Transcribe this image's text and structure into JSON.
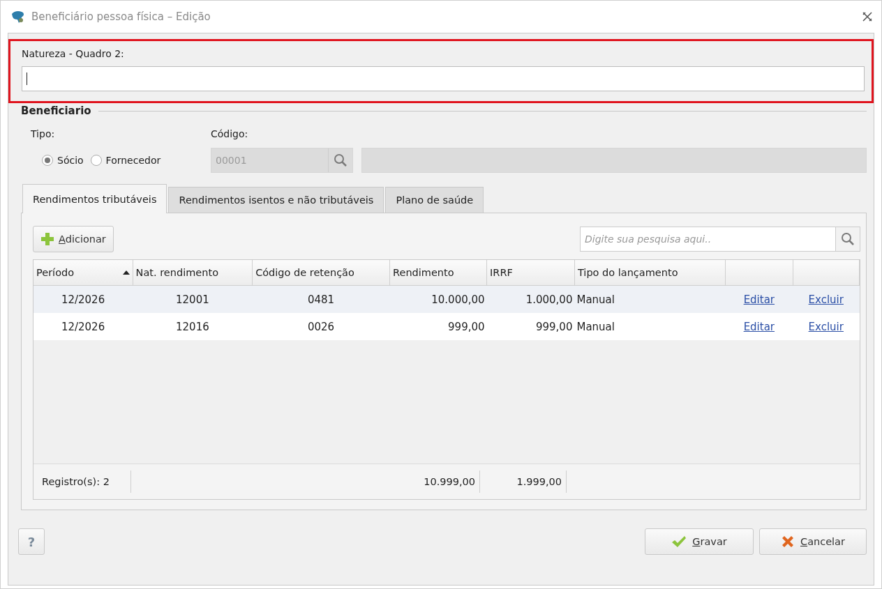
{
  "window": {
    "title": "Beneficiário pessoa física – Edição"
  },
  "natureza": {
    "label": "Natureza - Quadro 2:",
    "focused": true
  },
  "beneficiario": {
    "legend": "Beneficiario",
    "tipo_label": "Tipo:",
    "options": [
      {
        "label": "Sócio",
        "selected": true
      },
      {
        "label": "Fornecedor",
        "selected": false
      }
    ],
    "codigo_label": "Código:",
    "codigo_value": "00001",
    "disabled": true
  },
  "tabs": [
    {
      "label": "Rendimentos tributáveis",
      "selected": true
    },
    {
      "label": "Rendimentos isentos e não tributáveis",
      "selected": false
    },
    {
      "label": "Plano de saúde",
      "selected": false
    }
  ],
  "toolbar": {
    "add_button": "Adicionar",
    "search_placeholder": "Digite sua pesquisa aqui.."
  },
  "table": {
    "columns": [
      {
        "label": "Período",
        "sorted": true
      },
      {
        "label": "Nat. rendimento",
        "sorted": false
      },
      {
        "label": "Código de retenção",
        "sorted": false
      },
      {
        "label": "Rendimento",
        "sorted": false
      },
      {
        "label": "IRRF",
        "sorted": false
      },
      {
        "label": "Tipo do lançamento",
        "sorted": false
      },
      {
        "sorted": false
      },
      {
        "sorted": false
      }
    ],
    "rows": [
      {
        "selected": true,
        "cells": [
          "12/2026",
          "12001",
          "0481",
          "10.000,00",
          "1.000,00",
          "Manual"
        ],
        "links": [
          "Editar",
          "Excluir"
        ]
      },
      {
        "selected": false,
        "cells": [
          "12/2026",
          "12016",
          "0026",
          "999,00",
          "999,00",
          "Manual"
        ],
        "links": [
          "Editar",
          "Excluir"
        ]
      }
    ],
    "footer": {
      "count": "Registro(s): 2",
      "total_rendimento": "10.999,00",
      "total_irrf": "1.999,00"
    }
  },
  "buttons": [
    {
      "kind": "help",
      "label": "?"
    },
    {
      "kind": "save",
      "label": "Gravar"
    },
    {
      "kind": "cancel",
      "label": "Cancelar"
    }
  ]
}
